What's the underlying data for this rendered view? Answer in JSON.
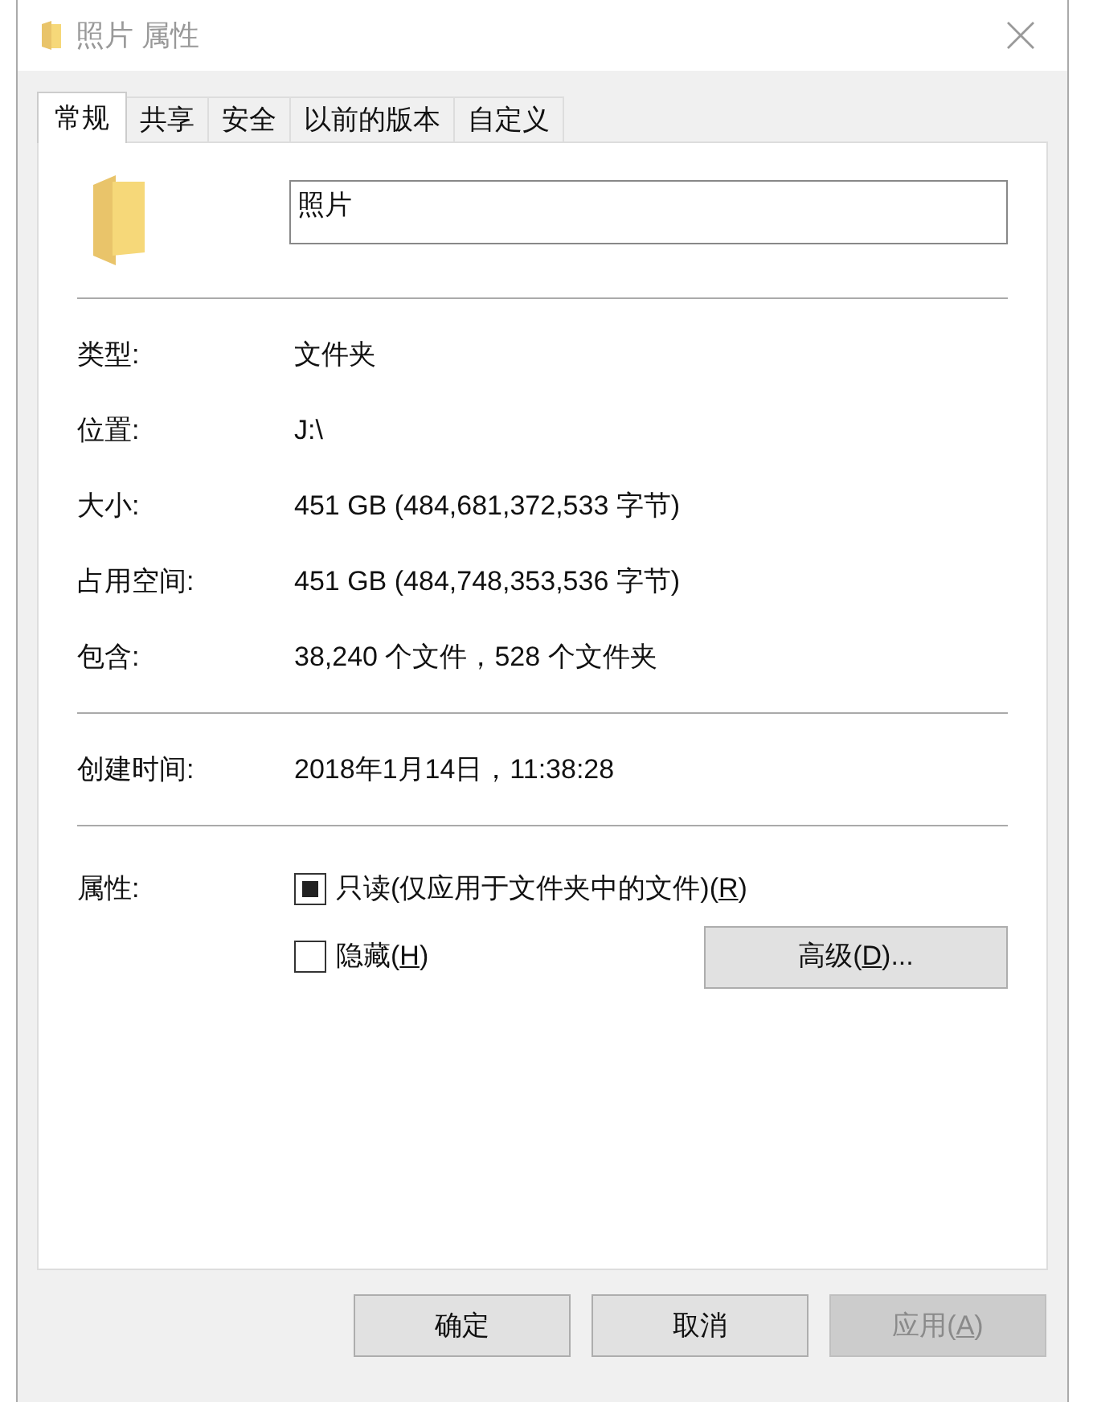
{
  "window": {
    "title": "照片 属性"
  },
  "tabs": [
    {
      "label": "常规",
      "selected": true
    },
    {
      "label": "共享",
      "selected": false
    },
    {
      "label": "安全",
      "selected": false
    },
    {
      "label": "以前的版本",
      "selected": false
    },
    {
      "label": "自定义",
      "selected": false
    }
  ],
  "name_field": {
    "value": "照片"
  },
  "info_groups": [
    [
      {
        "label": "类型:",
        "value": "文件夹"
      },
      {
        "label": "位置:",
        "value": "J:\\"
      },
      {
        "label": "大小:",
        "value": "451 GB (484,681,372,533 字节)"
      },
      {
        "label": "占用空间:",
        "value": "451 GB (484,748,353,536 字节)"
      },
      {
        "label": "包含:",
        "value": "38,240 个文件，528 个文件夹"
      }
    ],
    [
      {
        "label": "创建时间:",
        "value": "2018年1月14日，11:38:28"
      }
    ]
  ],
  "attributes": {
    "label": "属性:",
    "options": [
      {
        "before": "只读(仅应用于文件夹中的文件)(",
        "key": "R",
        "after": ")",
        "checked": false,
        "mixed": true
      },
      {
        "before": "隐藏(",
        "key": "H",
        "after": ")",
        "checked": false,
        "mixed": false
      }
    ],
    "advanced_button": {
      "before": "高级(",
      "key": "D",
      "after": ")..."
    }
  },
  "buttons": [
    {
      "label": "确定",
      "disabled": false
    },
    {
      "label": "取消",
      "disabled": false
    },
    {
      "before": "应用(",
      "key": "A",
      "after": ")",
      "disabled": true
    }
  ]
}
